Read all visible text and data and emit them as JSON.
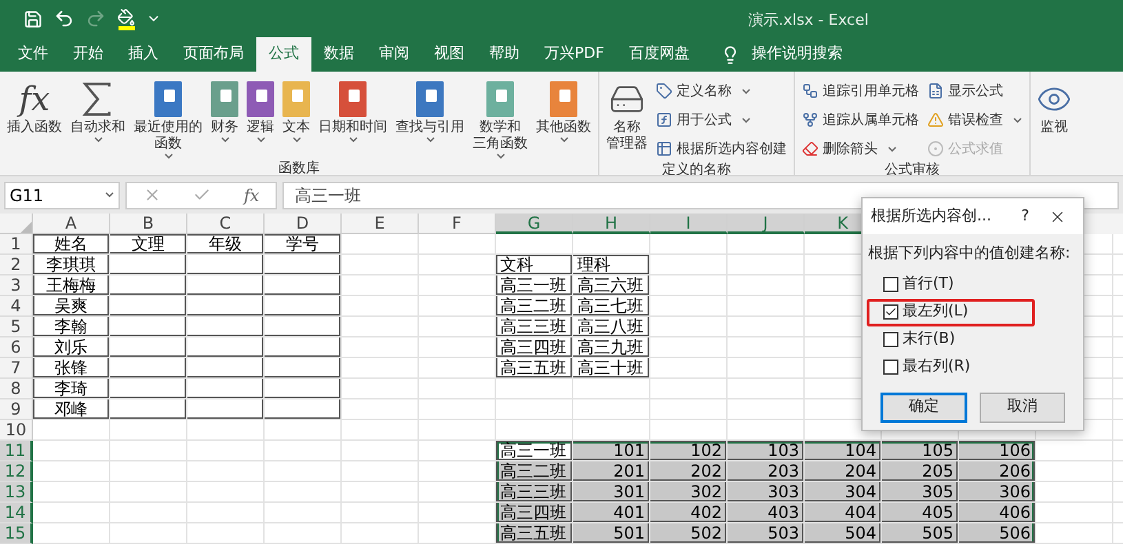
{
  "title_bar": {
    "title": "演示.xlsx  -  Excel",
    "quick_access": [
      {
        "kind": "save",
        "disabled": false
      },
      {
        "kind": "undo",
        "disabled": false
      },
      {
        "kind": "redo",
        "disabled": true
      },
      {
        "kind": "fill",
        "disabled": false
      },
      {
        "kind": "customize",
        "disabled": false
      }
    ]
  },
  "menu_tabs": [
    {
      "label": "文件",
      "selected": false
    },
    {
      "label": "开始",
      "selected": false
    },
    {
      "label": "插入",
      "selected": false
    },
    {
      "label": "页面布局",
      "selected": false
    },
    {
      "label": "公式",
      "selected": true
    },
    {
      "label": "数据",
      "selected": false
    },
    {
      "label": "审阅",
      "selected": false
    },
    {
      "label": "视图",
      "selected": false
    },
    {
      "label": "帮助",
      "selected": false
    },
    {
      "label": "万兴PDF",
      "selected": false
    },
    {
      "label": "百度网盘",
      "selected": false
    }
  ],
  "search": {
    "label": "操作说明搜索"
  },
  "ribbon": {
    "groups": [
      {
        "label": "函数库",
        "large": [
          {
            "lines": [
              "插入函数"
            ],
            "kind": "fx",
            "glyph": "fx",
            "dropdown": false
          },
          {
            "lines": [
              "自动求和"
            ],
            "kind": "sum",
            "dropdown": true
          },
          {
            "lines": [
              "最近使用的",
              "函数"
            ],
            "kind": "book",
            "color": "#3b78c3",
            "dropdown": true
          },
          {
            "lines": [
              "财务"
            ],
            "kind": "book",
            "color": "#6a9f8c",
            "dropdown": true
          },
          {
            "lines": [
              "逻辑"
            ],
            "kind": "book",
            "color": "#8e5bb5",
            "dropdown": true
          },
          {
            "lines": [
              "文本"
            ],
            "kind": "book",
            "color": "#e8b54f",
            "dropdown": true
          },
          {
            "lines": [
              "日期和时间"
            ],
            "kind": "book",
            "color": "#d6503b",
            "dropdown": true
          },
          {
            "lines": [
              "查找与引用"
            ],
            "kind": "book",
            "color": "#3d78c0",
            "dropdown": true
          },
          {
            "lines": [
              "数学和",
              "三角函数"
            ],
            "kind": "book",
            "color": "#6db09e",
            "dropdown": true
          },
          {
            "lines": [
              "其他函数"
            ],
            "kind": "book",
            "color": "#e8843c",
            "dropdown": true
          }
        ]
      },
      {
        "label": "定义的名称",
        "large": [
          {
            "lines": [
              "名称",
              "管理器"
            ],
            "kind": "drive",
            "dropdown": false
          }
        ],
        "columns": [
          [
            {
              "label": "定义名称",
              "kind": "tag",
              "dropdown": true,
              "disabled": false
            },
            {
              "label": "用于公式",
              "kind": "formula",
              "dropdown": true,
              "disabled": false
            },
            {
              "label": "根据所选内容创建",
              "kind": "create",
              "dropdown": false,
              "disabled": false
            }
          ]
        ]
      },
      {
        "label": "公式审核",
        "columns": [
          [
            {
              "label": "追踪引用单元格",
              "kind": "precedents",
              "dropdown": false,
              "disabled": false
            },
            {
              "label": "追踪从属单元格",
              "kind": "dependents",
              "dropdown": false,
              "disabled": false
            },
            {
              "label": "删除箭头",
              "kind": "remove",
              "dropdown": true,
              "disabled": false
            }
          ],
          [
            {
              "label": "显示公式",
              "kind": "show",
              "dropdown": false,
              "disabled": false
            },
            {
              "label": "错误检查",
              "kind": "error",
              "dropdown": true,
              "disabled": false
            },
            {
              "label": "公式求值",
              "kind": "evaluate",
              "dropdown": false,
              "disabled": true
            }
          ]
        ]
      }
    ],
    "watch": {
      "label": "监视"
    }
  },
  "formula_bar": {
    "name_box": "G11",
    "function_symbol": "fx",
    "value": "高三一班"
  },
  "sheet": {
    "columns": [
      {
        "letter": "A",
        "selected": false
      },
      {
        "letter": "B",
        "selected": false
      },
      {
        "letter": "C",
        "selected": false
      },
      {
        "letter": "D",
        "selected": false
      },
      {
        "letter": "E",
        "selected": false
      },
      {
        "letter": "F",
        "selected": false
      },
      {
        "letter": "G",
        "selected": true
      },
      {
        "letter": "H",
        "selected": true
      },
      {
        "letter": "I",
        "selected": true
      },
      {
        "letter": "J",
        "selected": true
      },
      {
        "letter": "K",
        "selected": true
      }
    ],
    "rows": [
      {
        "header": "1",
        "selected": false,
        "cells": [
          {
            "text": "姓名",
            "kind": "label",
            "bordered": true
          },
          {
            "text": "文理",
            "kind": "label",
            "bordered": true
          },
          {
            "text": "年级",
            "kind": "label",
            "bordered": true
          },
          {
            "text": "学号",
            "kind": "label",
            "bordered": true
          },
          null,
          null,
          null,
          null,
          null,
          null,
          null,
          null,
          null,
          null
        ]
      },
      {
        "header": "2",
        "selected": false,
        "cells": [
          {
            "text": "李琪琪",
            "kind": "label",
            "bordered": true
          },
          {
            "kind": "blank",
            "bordered": true
          },
          {
            "kind": "blank",
            "bordered": true
          },
          {
            "kind": "blank",
            "bordered": true
          },
          null,
          null,
          {
            "text": "文科",
            "kind": "text",
            "bordered": true
          },
          {
            "text": "理科",
            "kind": "text",
            "bordered": true
          },
          null,
          null,
          null,
          null,
          null,
          null
        ]
      },
      {
        "header": "3",
        "selected": false,
        "cells": [
          {
            "text": "王梅梅",
            "kind": "label",
            "bordered": true
          },
          {
            "kind": "blank",
            "bordered": true
          },
          {
            "kind": "blank",
            "bordered": true
          },
          {
            "kind": "blank",
            "bordered": true
          },
          null,
          null,
          {
            "text": "高三一班",
            "kind": "text",
            "bordered": true
          },
          {
            "text": "高三六班",
            "kind": "text",
            "bordered": true
          },
          null,
          null,
          null,
          null,
          null,
          null
        ]
      },
      {
        "header": "4",
        "selected": false,
        "cells": [
          {
            "text": "吴爽",
            "kind": "label",
            "bordered": true
          },
          {
            "kind": "blank",
            "bordered": true
          },
          {
            "kind": "blank",
            "bordered": true
          },
          {
            "kind": "blank",
            "bordered": true
          },
          null,
          null,
          {
            "text": "高三二班",
            "kind": "text",
            "bordered": true
          },
          {
            "text": "高三七班",
            "kind": "text",
            "bordered": true
          },
          null,
          null,
          null,
          null,
          null,
          null
        ]
      },
      {
        "header": "5",
        "selected": false,
        "cells": [
          {
            "text": "李翰",
            "kind": "label",
            "bordered": true
          },
          {
            "kind": "blank",
            "bordered": true
          },
          {
            "kind": "blank",
            "bordered": true
          },
          {
            "kind": "blank",
            "bordered": true
          },
          null,
          null,
          {
            "text": "高三三班",
            "kind": "text",
            "bordered": true
          },
          {
            "text": "高三八班",
            "kind": "text",
            "bordered": true
          },
          null,
          null,
          null,
          null,
          null,
          null
        ]
      },
      {
        "header": "6",
        "selected": false,
        "cells": [
          {
            "text": "刘乐",
            "kind": "label",
            "bordered": true
          },
          {
            "kind": "blank",
            "bordered": true
          },
          {
            "kind": "blank",
            "bordered": true
          },
          {
            "kind": "blank",
            "bordered": true
          },
          null,
          null,
          {
            "text": "高三四班",
            "kind": "text",
            "bordered": true
          },
          {
            "text": "高三九班",
            "kind": "text",
            "bordered": true
          },
          null,
          null,
          null,
          null,
          null,
          null
        ]
      },
      {
        "header": "7",
        "selected": false,
        "cells": [
          {
            "text": "张锋",
            "kind": "label",
            "bordered": true
          },
          {
            "kind": "blank",
            "bordered": true
          },
          {
            "kind": "blank",
            "bordered": true
          },
          {
            "kind": "blank",
            "bordered": true
          },
          null,
          null,
          {
            "text": "高三五班",
            "kind": "text",
            "bordered": true
          },
          {
            "text": "高三十班",
            "kind": "text",
            "bordered": true
          },
          null,
          null,
          null,
          null,
          null,
          null
        ]
      },
      {
        "header": "8",
        "selected": false,
        "cells": [
          {
            "text": "李琦",
            "kind": "label",
            "bordered": true
          },
          {
            "kind": "blank",
            "bordered": true
          },
          {
            "kind": "blank",
            "bordered": true
          },
          {
            "kind": "blank",
            "bordered": true
          },
          null,
          null,
          null,
          null,
          null,
          null,
          null,
          null,
          null,
          null
        ]
      },
      {
        "header": "9",
        "selected": false,
        "cells": [
          {
            "text": "邓峰",
            "kind": "label",
            "bordered": true
          },
          {
            "kind": "blank",
            "bordered": true
          },
          {
            "kind": "blank",
            "bordered": true
          },
          {
            "kind": "blank",
            "bordered": true
          },
          null,
          null,
          null,
          null,
          null,
          null,
          null,
          null,
          null,
          null
        ]
      },
      {
        "header": "10",
        "selected": false,
        "cells": [
          null,
          null,
          null,
          null,
          null,
          null,
          null,
          null,
          null,
          null,
          null,
          null,
          null,
          null
        ]
      },
      {
        "header": "11",
        "selected": true,
        "cells": [
          null,
          null,
          null,
          null,
          null,
          null,
          {
            "text": "高三一班",
            "kind": "text",
            "bordered": true,
            "selected": true,
            "active": true
          },
          {
            "text": "101",
            "kind": "number",
            "bordered": true,
            "selected": true,
            "active": false
          },
          {
            "text": "102",
            "kind": "number",
            "bordered": true,
            "selected": true,
            "active": false
          },
          {
            "text": "103",
            "kind": "number",
            "bordered": true,
            "selected": true,
            "active": false
          },
          {
            "text": "104",
            "kind": "number",
            "bordered": true,
            "selected": true,
            "active": false
          },
          {
            "text": "105",
            "kind": "number",
            "bordered": true,
            "selected": true,
            "active": false
          },
          {
            "text": "106",
            "kind": "number",
            "bordered": true,
            "selected": true,
            "active": false
          },
          null
        ]
      },
      {
        "header": "12",
        "selected": true,
        "cells": [
          null,
          null,
          null,
          null,
          null,
          null,
          {
            "text": "高三二班",
            "kind": "text",
            "bordered": true,
            "selected": true,
            "active": false
          },
          {
            "text": "201",
            "kind": "number",
            "bordered": true,
            "selected": true,
            "active": false
          },
          {
            "text": "202",
            "kind": "number",
            "bordered": true,
            "selected": true,
            "active": false
          },
          {
            "text": "203",
            "kind": "number",
            "bordered": true,
            "selected": true,
            "active": false
          },
          {
            "text": "204",
            "kind": "number",
            "bordered": true,
            "selected": true,
            "active": false
          },
          {
            "text": "205",
            "kind": "number",
            "bordered": true,
            "selected": true,
            "active": false
          },
          {
            "text": "206",
            "kind": "number",
            "bordered": true,
            "selected": true,
            "active": false
          },
          null
        ]
      },
      {
        "header": "13",
        "selected": true,
        "cells": [
          null,
          null,
          null,
          null,
          null,
          null,
          {
            "text": "高三三班",
            "kind": "text",
            "bordered": true,
            "selected": true,
            "active": false
          },
          {
            "text": "301",
            "kind": "number",
            "bordered": true,
            "selected": true,
            "active": false
          },
          {
            "text": "302",
            "kind": "number",
            "bordered": true,
            "selected": true,
            "active": false
          },
          {
            "text": "303",
            "kind": "number",
            "bordered": true,
            "selected": true,
            "active": false
          },
          {
            "text": "304",
            "kind": "number",
            "bordered": true,
            "selected": true,
            "active": false
          },
          {
            "text": "305",
            "kind": "number",
            "bordered": true,
            "selected": true,
            "active": false
          },
          {
            "text": "306",
            "kind": "number",
            "bordered": true,
            "selected": true,
            "active": false
          },
          null
        ]
      },
      {
        "header": "14",
        "selected": true,
        "cells": [
          null,
          null,
          null,
          null,
          null,
          null,
          {
            "text": "高三四班",
            "kind": "text",
            "bordered": true,
            "selected": true,
            "active": false
          },
          {
            "text": "401",
            "kind": "number",
            "bordered": true,
            "selected": true,
            "active": false
          },
          {
            "text": "402",
            "kind": "number",
            "bordered": true,
            "selected": true,
            "active": false
          },
          {
            "text": "403",
            "kind": "number",
            "bordered": true,
            "selected": true,
            "active": false
          },
          {
            "text": "404",
            "kind": "number",
            "bordered": true,
            "selected": true,
            "active": false
          },
          {
            "text": "405",
            "kind": "number",
            "bordered": true,
            "selected": true,
            "active": false
          },
          {
            "text": "406",
            "kind": "number",
            "bordered": true,
            "selected": true,
            "active": false
          },
          null
        ]
      },
      {
        "header": "15",
        "selected": true,
        "cells": [
          null,
          null,
          null,
          null,
          null,
          null,
          {
            "text": "高三五班",
            "kind": "text",
            "bordered": true,
            "selected": true,
            "active": false
          },
          {
            "text": "501",
            "kind": "number",
            "bordered": true,
            "selected": true,
            "active": false
          },
          {
            "text": "502",
            "kind": "number",
            "bordered": true,
            "selected": true,
            "active": false
          },
          {
            "text": "503",
            "kind": "number",
            "bordered": true,
            "selected": true,
            "active": false
          },
          {
            "text": "504",
            "kind": "number",
            "bordered": true,
            "selected": true,
            "active": false
          },
          {
            "text": "505",
            "kind": "number",
            "bordered": true,
            "selected": true,
            "active": false
          },
          {
            "text": "506",
            "kind": "number",
            "bordered": true,
            "selected": true,
            "active": false
          },
          null
        ]
      }
    ]
  },
  "dialog": {
    "title": "根据所选内容创...",
    "help": "?",
    "prompt": "根据下列内容中的值创建名称:",
    "options": [
      {
        "label": "首行(T)",
        "checked": false,
        "highlighted": false
      },
      {
        "label": "最左列(L)",
        "checked": true,
        "highlighted": true
      },
      {
        "label": "末行(B)",
        "checked": false,
        "highlighted": false
      },
      {
        "label": "最右列(R)",
        "checked": false,
        "highlighted": false
      }
    ],
    "buttons": [
      {
        "label": "确定",
        "selected": true
      },
      {
        "label": "取消",
        "selected": false
      }
    ]
  }
}
